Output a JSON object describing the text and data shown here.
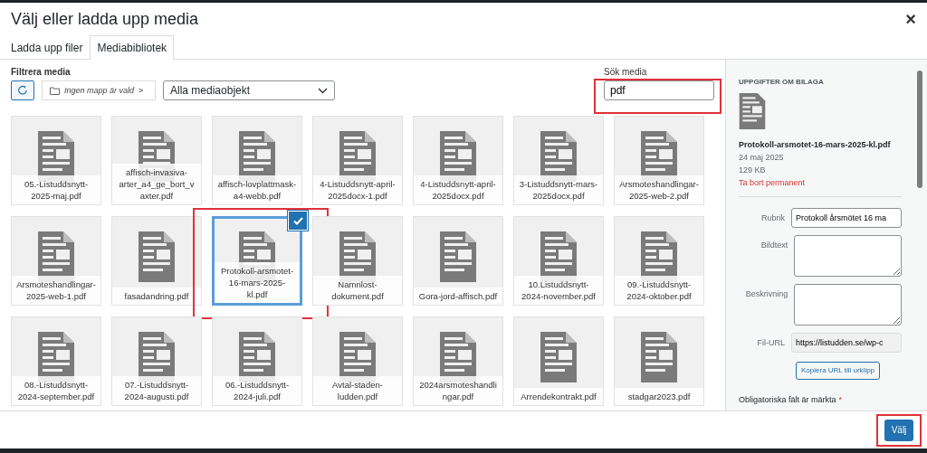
{
  "window": {
    "title": "Välj eller ladda upp media",
    "close": "×"
  },
  "tabs": [
    {
      "label": "Ladda upp filer",
      "selected": false
    },
    {
      "label": "Mediabibliotek",
      "selected": true
    }
  ],
  "filters": {
    "label": "Filtrera media",
    "folder": "Ingen mapp är vald",
    "folder_arrow": ">",
    "type_select": "Alla mediaobjekt"
  },
  "search": {
    "label": "Sök media",
    "value": "pdf",
    "highlighted": true
  },
  "items": [
    {
      "name": "05.-Listuddsnytt-2025-maj.pdf",
      "selected": false,
      "highlighted": false
    },
    {
      "name": "affisch-invasiva-arter_a4_ge_bort_vaxter.pdf",
      "selected": false,
      "highlighted": false
    },
    {
      "name": "affisch-lovplattmask-a4-webb.pdf",
      "selected": false,
      "highlighted": false
    },
    {
      "name": "4-Listuddsnytt-april-2025docx-1.pdf",
      "selected": false,
      "highlighted": false
    },
    {
      "name": "4-Listuddsnytt-april-2025docx.pdf",
      "selected": false,
      "highlighted": false
    },
    {
      "name": "3-Listuddsnytt-mars-2025docx.pdf",
      "selected": false,
      "highlighted": false
    },
    {
      "name": "Arsmoteshandlingar-2025-web-2.pdf",
      "selected": false,
      "highlighted": false
    },
    {
      "name": "Arsmoteshandlingar-2025-web-1.pdf",
      "selected": false,
      "highlighted": false
    },
    {
      "name": "fasadandring.pdf",
      "selected": false,
      "highlighted": false
    },
    {
      "name": "Protokoll-arsmotet-16-mars-2025-kl.pdf",
      "selected": true,
      "highlighted": true
    },
    {
      "name": "Namnlost-dokument.pdf",
      "selected": false,
      "highlighted": false
    },
    {
      "name": "Gora-jord-affisch.pdf",
      "selected": false,
      "highlighted": false
    },
    {
      "name": "10.Listuddsnytt-2024-november.pdf",
      "selected": false,
      "highlighted": false
    },
    {
      "name": "09.-Listuddsnytt-2024-oktober.pdf",
      "selected": false,
      "highlighted": false
    },
    {
      "name": "08.-Listuddsnytt-2024-september.pdf",
      "selected": false,
      "highlighted": false
    },
    {
      "name": "07.-Listuddsnytt-2024-augusti.pdf",
      "selected": false,
      "highlighted": false
    },
    {
      "name": "06.-Listuddsnytt-2024-juli.pdf",
      "selected": false,
      "highlighted": false
    },
    {
      "name": "Avtal-staden-ludden.pdf",
      "selected": false,
      "highlighted": false
    },
    {
      "name": "2024arsmoteshandlingar.pdf",
      "selected": false,
      "highlighted": false
    },
    {
      "name": "Arrendekontrakt.pdf",
      "selected": false,
      "highlighted": false
    },
    {
      "name": "stadgar2023.pdf",
      "selected": false,
      "highlighted": false
    }
  ],
  "details": {
    "heading": "UPPGIFTER OM BILAGA",
    "filename": "Protokoll-arsmotet-16-mars-2025-kl.pdf",
    "date": "24 maj 2025",
    "size": "129 KB",
    "delete": "Ta bort permanent",
    "fields": [
      {
        "kind": "input",
        "label": "Rubrik",
        "value": "Protokoll årsmötet 16 ma"
      },
      {
        "kind": "textarea",
        "label": "Bildtext"
      },
      {
        "kind": "textarea",
        "label": "Beskrivning"
      },
      {
        "kind": "readonly",
        "label": "Fil-URL",
        "value": "https://listudden.se/wp-c"
      }
    ],
    "copy_button": "Kopiera URL till urklipp",
    "required_note": "Obligatoriska fält är märkta",
    "required_mark": "*"
  },
  "footer": {
    "button": "Välj",
    "highlighted": true
  }
}
